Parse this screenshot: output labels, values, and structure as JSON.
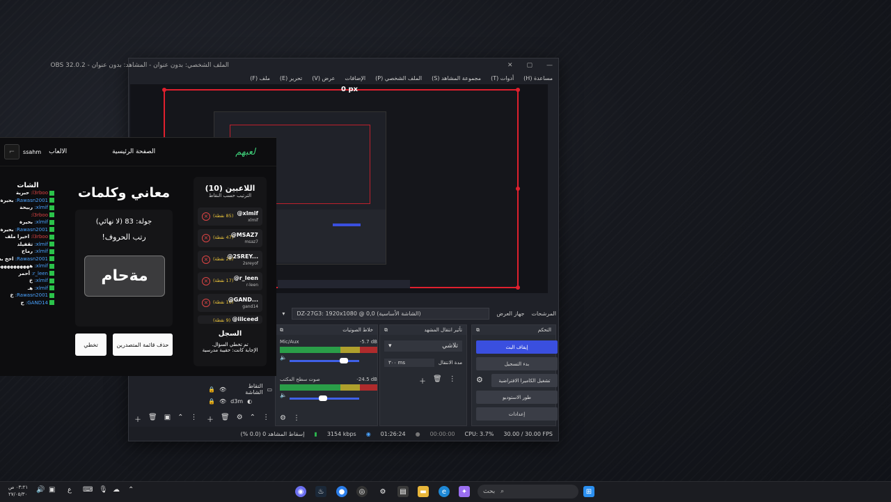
{
  "obs": {
    "title": "الملف الشخصي: بدون عنوان - المشاهد: بدون عنوان - OBS 32.0.2",
    "menu": [
      "ملف (F)",
      "تحرير (E)",
      "عرض (V)",
      "الإضافات",
      "الملف الشخصي (P)",
      "مجموعة المشاهد (S)",
      "أدوات (T)",
      "مساعدة (H)"
    ],
    "preview_px_label": "0 px",
    "scene_filter_label": "المرشحات",
    "display_label": "جهاز العرض",
    "display_value": "DZ-27G3: 1920x1080 @ 0,0 (الشاشة الأساسية)",
    "docks": {
      "controls_title": "التحكم",
      "controls_buttons": [
        "إيقاف البث",
        "بدء التسجيل",
        "تشغيل الكاميرا الافتراضية",
        "طور الاستوديو",
        "إعدادات"
      ],
      "transitions_title": "تأثير انتقال المشهد",
      "transition_value": "تلاشي",
      "duration_label": "مدة الانتقال",
      "duration_value": "٣٠٠ ms",
      "mixer_title": "خلاط الصوتيات",
      "mixer": [
        {
          "name": "Mic/Aux",
          "db": "-5.7 dB",
          "level": 0.82,
          "vol": 0.72
        },
        {
          "name": "صوت سطح المكتب",
          "db": "-24.5 dB",
          "level": 0.7,
          "vol": 0.42
        }
      ],
      "sources": [
        {
          "name": "التقاط الشاشة"
        },
        {
          "name": "d3m"
        }
      ]
    },
    "status": {
      "dropped": "إسقاط المشاهد 0 (0.0 %)",
      "bitrate": "3154 kbps",
      "stream_time": "01:26:24",
      "rec_time": "00:00:00",
      "cpu": "CPU: 3.7%",
      "fps": "30.00 / 30.00 FPS"
    }
  },
  "game": {
    "logo": "لعبهم",
    "nav_home": "الصفحة الرئيسية",
    "nav_games": "الالعاب",
    "user": "ssahm",
    "players_title": "اللاعبين (10)",
    "players_sub": "الترتيب حسب النقاط",
    "players": [
      {
        "name": "@xlmif",
        "user": "xlmif",
        "points": "(85 نقطة)"
      },
      {
        "name": "@MSAZ7",
        "user": "msaz7",
        "points": "(47 نقطة)"
      },
      {
        "name": "@2SREY...",
        "user": "2sreyof",
        "points": "(28 نقطة)"
      },
      {
        "name": "@r_leen",
        "user": "r-leen",
        "points": "(17 نقطة)"
      },
      {
        "name": "@GAND...",
        "user": "gand14",
        "points": "(16 نقطة)"
      },
      {
        "name": "@iiiceed",
        "user": "",
        "points": "(9 نقطة)"
      }
    ],
    "log_title": "السجل",
    "log_lines": [
      "تم تخطي السؤال.",
      "الإجابة كانت: حقيبة مدرسية"
    ],
    "game_title": "معاني وكلمات",
    "round": "جولة: 83 (لا نهائي)",
    "instruction": "رتب الحروف!",
    "scrambled_word": "مةحام",
    "skip_btn": "تخطي",
    "remove_btn": "حذف قائمة المتصدرين",
    "chat_title": "الشات",
    "chat": [
      {
        "user": "l3rboo:",
        "text": "حبرية"
      },
      {
        "user": "Rawasn2001:",
        "text": "بحيرة"
      },
      {
        "user": "xlmif:",
        "text": "ربيحة"
      },
      {
        "user": "l3rboo:",
        "text": ""
      },
      {
        "user": "xlmif:",
        "text": "بحيرة"
      },
      {
        "user": "Rawasn2001:",
        "text": "بحيرة"
      },
      {
        "user": "l3rboo:",
        "text": "اخيرا ملف"
      },
      {
        "user": "xlmif:",
        "text": "تقفيلد"
      },
      {
        "user": "xlmif:",
        "text": "رماح"
      },
      {
        "user": "Rawasn2001:",
        "text": "اخخ بس عشان الهاء مو تاء"
      },
      {
        "user": "xlmif:",
        "text": "ههههههههههه"
      },
      {
        "user": "r_leen:",
        "text": "أحمر"
      },
      {
        "user": "xlmif:",
        "text": "خ"
      },
      {
        "user": "xlmif:",
        "text": "هـ"
      },
      {
        "user": "Rawasn2001:",
        "text": "خ"
      },
      {
        "user": "GAND14:",
        "text": "ح"
      }
    ]
  },
  "taskbar": {
    "search_placeholder": "بحث",
    "time": "٠٣:٢١ ص",
    "date": "٢٧/٠٥/٣٠",
    "lang": "ع"
  }
}
